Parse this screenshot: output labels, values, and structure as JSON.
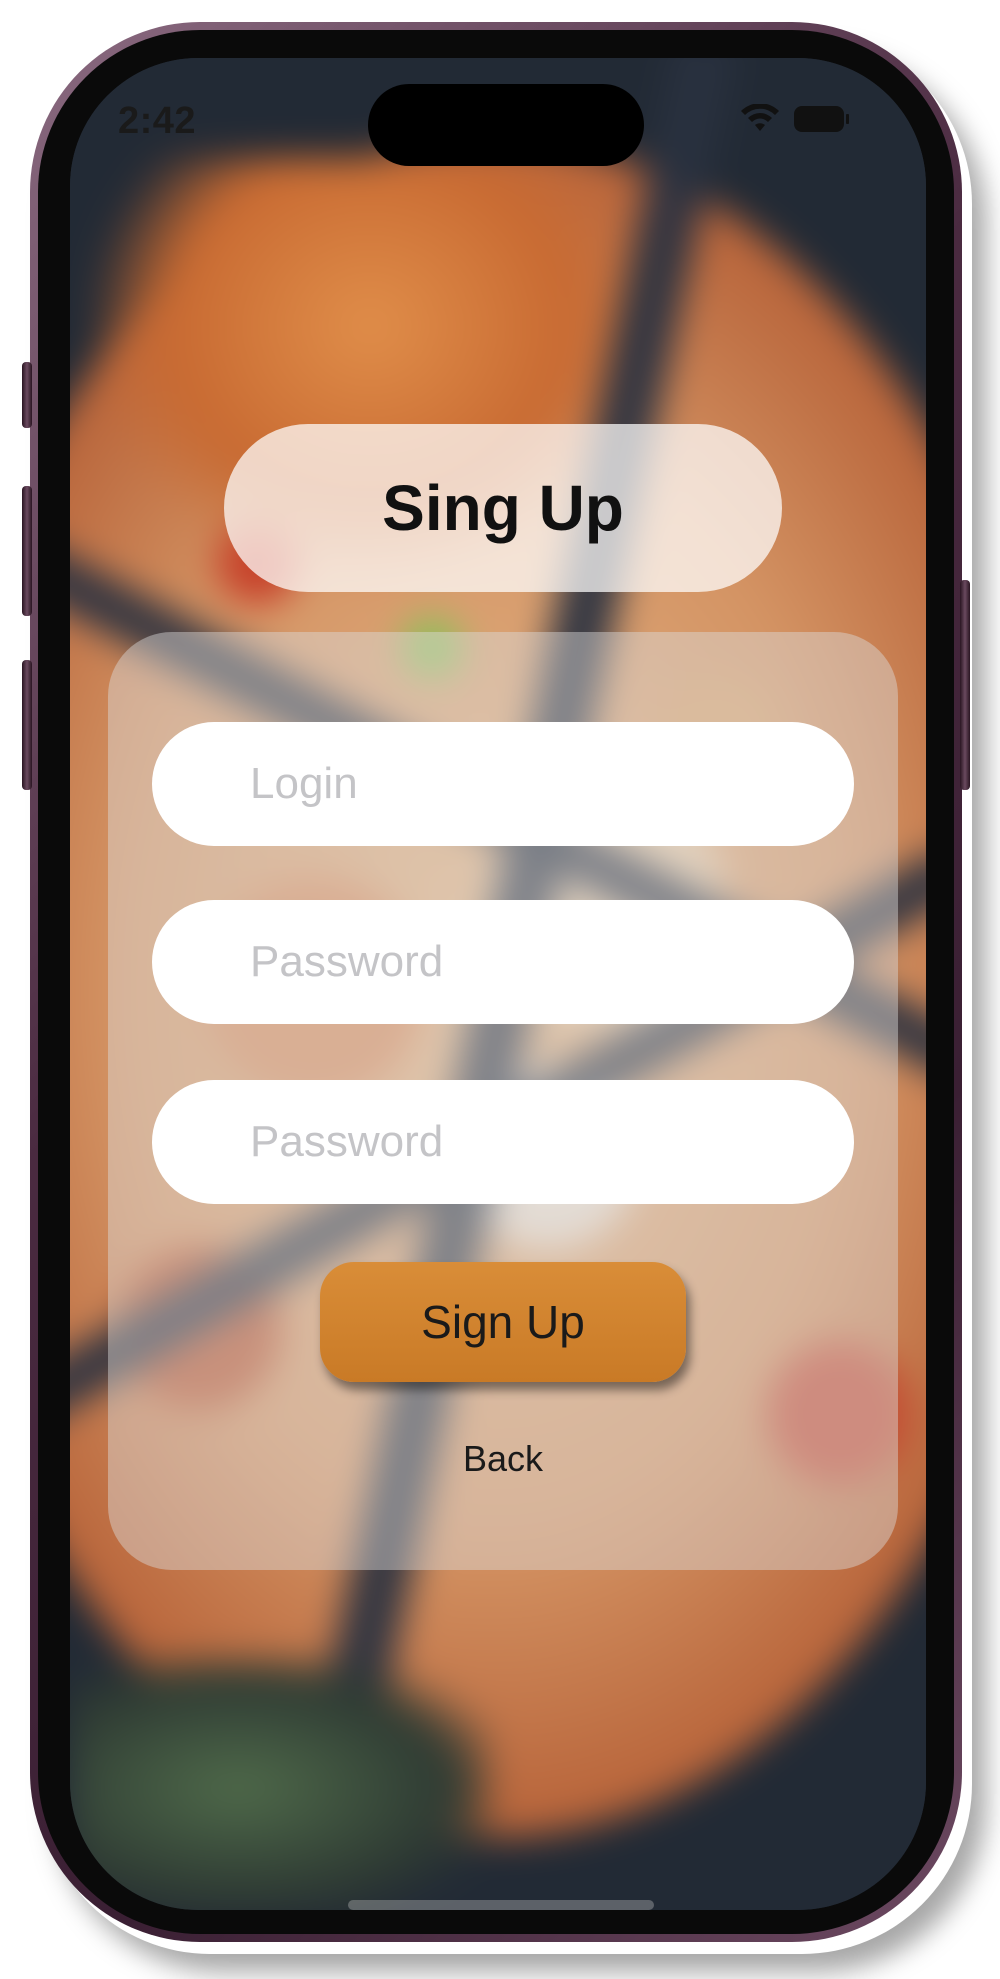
{
  "status_bar": {
    "time": "2:42",
    "icons": [
      "wifi-icon",
      "battery-icon"
    ]
  },
  "header": {
    "title": "Sing Up"
  },
  "form": {
    "login_placeholder": "Login",
    "password_placeholder": "Password",
    "confirm_password_placeholder": "Password",
    "submit_label": "Sign Up",
    "back_label": "Back"
  },
  "colors": {
    "accent": "#d2832f",
    "device_frame": "#4a2a40",
    "card_glass": "rgba(220,220,220,0.45)"
  }
}
